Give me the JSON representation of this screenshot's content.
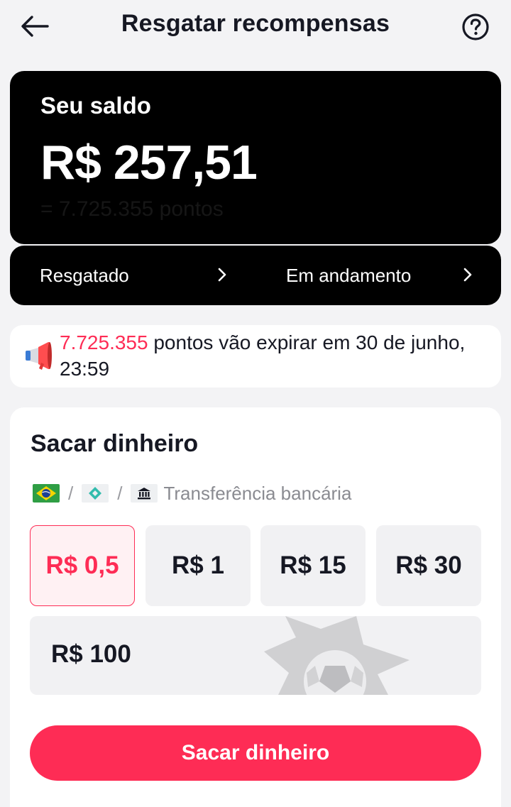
{
  "header": {
    "title": "Resgatar recompensas",
    "back_icon": "arrow-left-icon",
    "help_icon": "question-circle-icon"
  },
  "balance": {
    "label": "Seu saldo",
    "amount": "R$ 257,51",
    "points": "= 7.725.355 pontos"
  },
  "links": {
    "redeemed": "Resgatado",
    "in_progress": "Em andamento"
  },
  "notice": {
    "icon": "megaphone-icon",
    "points": "7.725.355",
    "text": " pontos vão expirar em 30 de junho, 23:59"
  },
  "withdraw": {
    "title": "Sacar dinheiro",
    "methods": {
      "bank_transfer_label": "Transferência bancária",
      "separator": "/"
    },
    "amounts": [
      "R$ 0,5",
      "R$ 1",
      "R$ 15",
      "R$ 30",
      "R$ 100"
    ],
    "selected_amount": "R$ 0,5",
    "cta": "Sacar dinheiro"
  },
  "colors": {
    "accent": "#fe2c55",
    "card_dark": "#000000",
    "background": "#f3f3f5",
    "chip_bg": "#f1f1f3"
  }
}
